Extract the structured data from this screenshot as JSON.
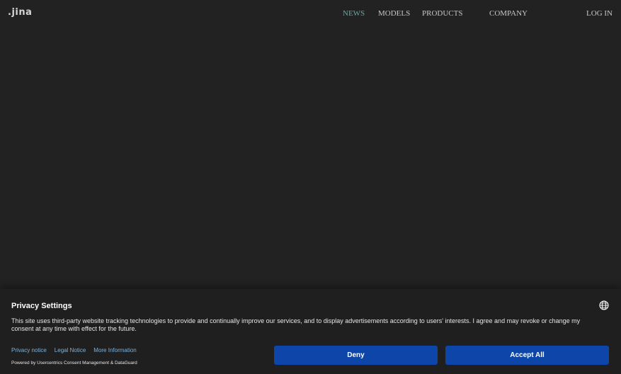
{
  "header": {
    "logo_text": ".jina",
    "nav": [
      {
        "label": "NEWS",
        "active": true
      },
      {
        "label": "MODELS",
        "active": false
      },
      {
        "label": "PRODUCTS",
        "active": false
      },
      {
        "label": "COMPANY",
        "active": false
      }
    ],
    "login_label": "LOG IN"
  },
  "consent": {
    "title": "Privacy Settings",
    "language_icon": "globe-icon",
    "body": "This site uses third-party website tracking technologies to provide and continually improve our services, and to display advertisements according to users' interests. I agree and may revoke or change my consent at any time with effect for the future.",
    "links": {
      "privacy_notice": "Privacy notice",
      "legal_notice": "Legal Notice",
      "more_information": "More Information"
    },
    "powered_by": "Powered by Usercentrics Consent Management & DataGuard",
    "deny_label": "Deny",
    "accept_label": "Accept All"
  },
  "colors": {
    "background": "#222222",
    "banner": "#1f1f1f",
    "accent_nav": "#6ba6a0",
    "button": "#0e45a8",
    "link": "#7fb3d9"
  }
}
